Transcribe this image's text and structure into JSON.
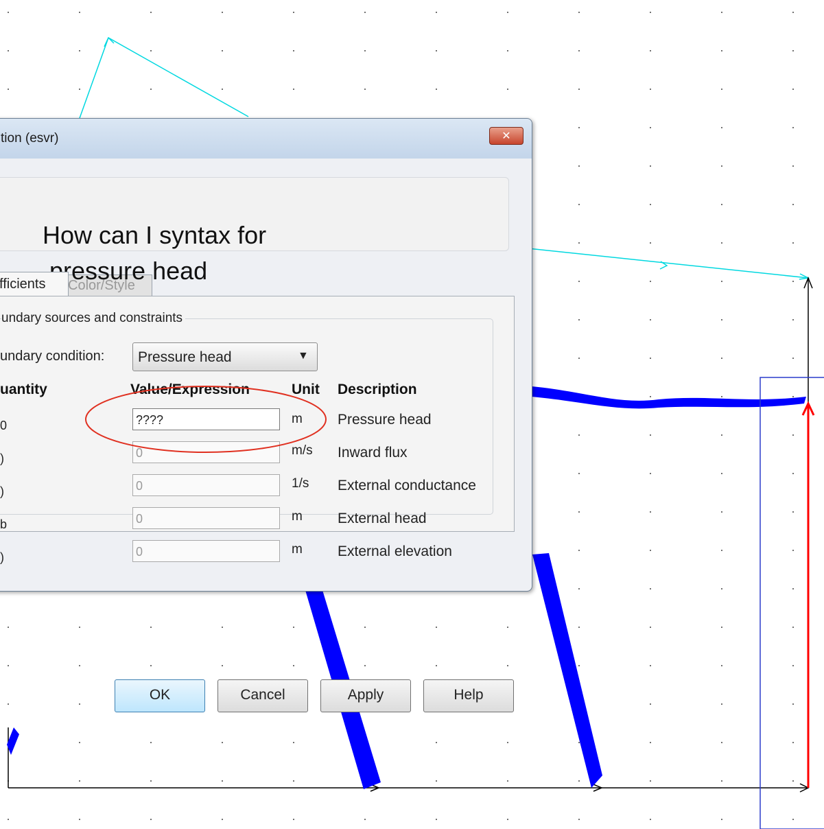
{
  "canvas": {
    "colors": {
      "flow": "#0000ff",
      "edge": "#00d8e0",
      "accent": "#ff0000",
      "axis": "#000000",
      "selection": "#2a3ccc"
    }
  },
  "dialog": {
    "title": "tion (esvr)",
    "close_icon": "close-icon",
    "tabs": [
      {
        "label": "fficients"
      },
      {
        "label": "Color/Style"
      }
    ],
    "group_label": "undary sources and constraints",
    "boundary_condition": {
      "label": "undary condition:",
      "value": "Pressure head"
    },
    "table": {
      "headers": [
        "uantity",
        "Value/Expression",
        "Unit",
        "Description"
      ],
      "rows": [
        {
          "quantity": "0",
          "value": "????",
          "unit": "m",
          "description": "Pressure head"
        },
        {
          "quantity": ")",
          "value": "0",
          "unit": "m/s",
          "description": "Inward flux"
        },
        {
          "quantity": ")",
          "value": "0",
          "unit": "1/s",
          "description": "External conductance"
        },
        {
          "quantity": "b",
          "value": "0",
          "unit": "m",
          "description": "External head"
        },
        {
          "quantity": ")",
          "value": "0",
          "unit": "m",
          "description": "External elevation"
        }
      ]
    },
    "buttons": {
      "ok": "OK",
      "cancel": "Cancel",
      "apply": "Apply",
      "help": "Help"
    }
  },
  "annotation": {
    "line1": "How can I syntax for",
    "line2": "pressure head",
    "highlight_color": "#e03020"
  }
}
